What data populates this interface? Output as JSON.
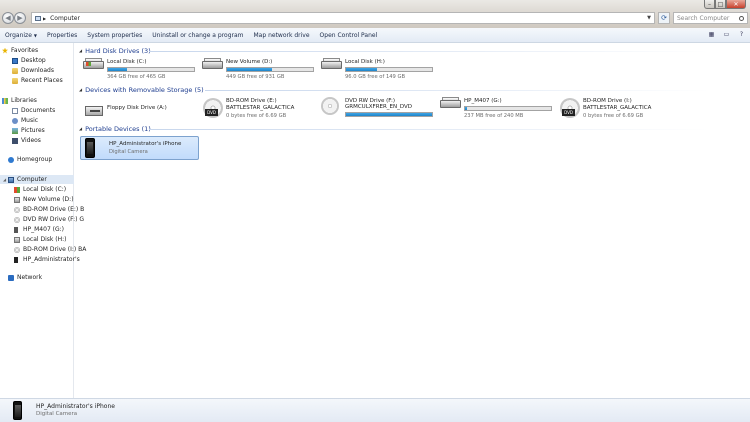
{
  "window": {
    "controls": {
      "min": "–",
      "max": "□",
      "close": "✕"
    }
  },
  "address": {
    "crumb": "Computer",
    "search_placeholder": "Search Computer"
  },
  "toolbar": {
    "items": [
      "Organize",
      "Properties",
      "System properties",
      "Uninstall or change a program",
      "Map network drive",
      "Open Control Panel"
    ]
  },
  "nav": {
    "favorites": {
      "title": "Favorites",
      "items": [
        "Desktop",
        "Downloads",
        "Recent Places"
      ]
    },
    "libraries": {
      "title": "Libraries",
      "items": [
        "Documents",
        "Music",
        "Pictures",
        "Videos"
      ]
    },
    "homegroup": "Homegroup",
    "computer": {
      "title": "Computer",
      "items": [
        "Local Disk (C:)",
        "New Volume (D:)",
        "BD-ROM Drive (E:) B",
        "DVD RW Drive (F:) G",
        "HP_M407 (G:)",
        "Local Disk (H:)",
        "BD-ROM Drive (I:) BA",
        "HP_Administrator's"
      ]
    },
    "network": "Network"
  },
  "groups": {
    "hdd": "Hard Disk Drives (3)",
    "removable": "Devices with Removable Storage (5)",
    "portable": "Portable Devices (1)"
  },
  "drives": {
    "c": {
      "name": "Local Disk (C:)",
      "free": "364 GB free of 465 GB",
      "used_fraction": 0.22
    },
    "d": {
      "name": "New Volume (D:)",
      "free": "449 GB free of 931 GB",
      "used_fraction": 0.52
    },
    "h": {
      "name": "Local Disk (H:)",
      "free": "96.0 GB free of 149 GB",
      "used_fraction": 0.36
    },
    "a": {
      "name": "Floppy Disk Drive (A:)"
    },
    "e": {
      "name": "BD-ROM Drive (E:)",
      "label": "BATTLESTAR_GALACTICA",
      "free": "0 bytes free of 6.69 GB"
    },
    "f": {
      "name": "DVD RW Drive (F:)",
      "label": "GRMCULXFRER_EN_DVD",
      "used_fraction": 1.0
    },
    "g": {
      "name": "HP_M407 (G:)",
      "free": "237 MB free of 240 MB",
      "used_fraction": 0.02
    },
    "i": {
      "name": "BD-ROM Drive (I:)",
      "label": "BATTLESTAR_GALACTICA",
      "free": "0 bytes free of 6.69 GB"
    }
  },
  "dvd_tag": "DVD",
  "device": {
    "name": "HP_Administrator's iPhone",
    "type": "Digital Camera"
  },
  "details": {
    "name": "HP_Administrator's iPhone",
    "type": "Digital Camera"
  }
}
